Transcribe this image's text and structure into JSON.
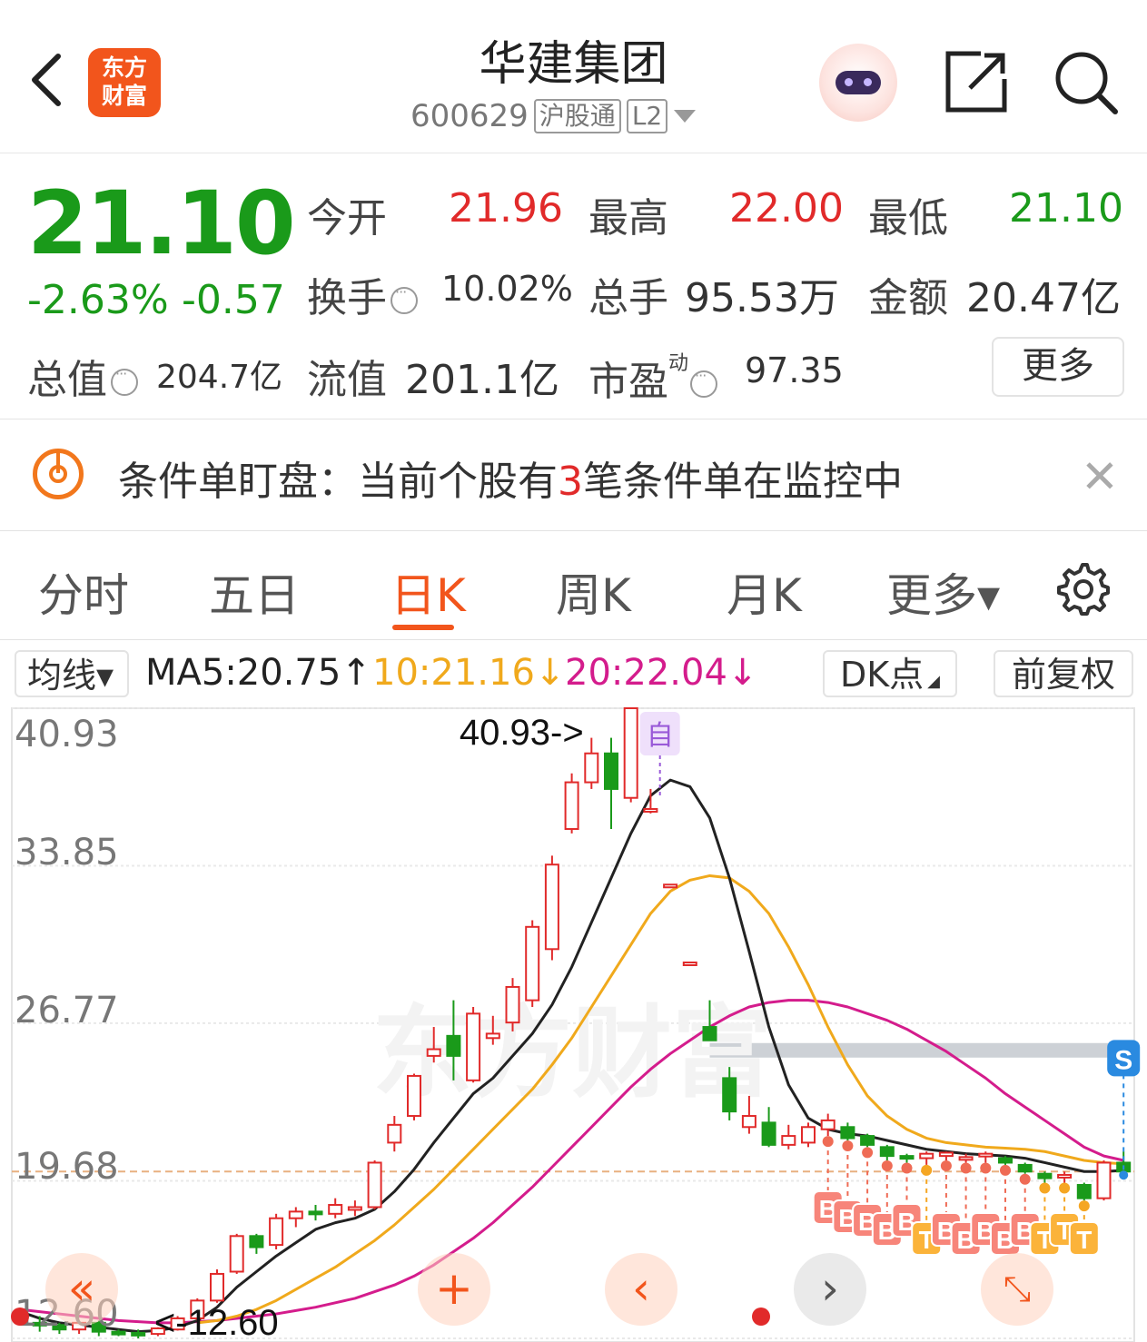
{
  "header": {
    "app_logo_text": "东方\n财富",
    "stock_name": "华建集团",
    "stock_code": "600629",
    "tags": [
      "沪股通",
      "L2"
    ]
  },
  "quote": {
    "price": "21.10",
    "change_pct": "-2.63%",
    "change_abs": "-0.57",
    "open_label": "今开",
    "open": "21.96",
    "high_label": "最高",
    "high": "22.00",
    "low_label": "最低",
    "low": "21.10",
    "turnover_label": "换手",
    "turnover": "10.02%",
    "volume_label": "总手",
    "volume": "95.53万",
    "amount_label": "金额",
    "amount": "20.47亿",
    "mktcap_label": "总值",
    "mktcap": "204.7亿",
    "float_label": "流值",
    "float_cap": "201.1亿",
    "pe_label": "市盈",
    "pe_sup": "动",
    "pe": "97.35",
    "more_label": "更多"
  },
  "alert": {
    "prefix": "条件单盯盘：当前个股有",
    "count": "3",
    "suffix": "笔条件单在监控中"
  },
  "tabs": [
    {
      "label": "分时"
    },
    {
      "label": "五日"
    },
    {
      "label": "日K"
    },
    {
      "label": "周K"
    },
    {
      "label": "月K"
    },
    {
      "label": "更多▾"
    }
  ],
  "indicator_bar": {
    "ma_select": "均线▾",
    "ma5": "MA5:20.75↑",
    "ma10": "10:21.16↓",
    "ma20": "20:22.04↓",
    "dk_label": "DK点",
    "adjust_label": "前复权",
    "colors": {
      "ma5": "#222222",
      "ma10": "#f0a91c",
      "ma20": "#d41c8c",
      "up": "#e12a2a",
      "down": "#1a9a1a"
    }
  },
  "chart_data": {
    "type": "candlestick",
    "y_ticks": [
      "40.93",
      "33.85",
      "26.77",
      "19.68",
      "12.60"
    ],
    "ylim": [
      12.6,
      40.93
    ],
    "max_annotation": "40.93->",
    "max_badge": "自",
    "min_annotation": "<-12.60",
    "sell_badge": "S",
    "signal_badges": [
      "B",
      "B",
      "B",
      "B",
      "B",
      "T",
      "B",
      "B",
      "B",
      "B",
      "B",
      "T",
      "T",
      "T"
    ],
    "watermark": "东方财富",
    "candles": [
      [
        13.6,
        13.9,
        13.2,
        13.4
      ],
      [
        13.3,
        13.6,
        12.9,
        13.2
      ],
      [
        13.2,
        13.3,
        12.8,
        13.0
      ],
      [
        13.0,
        13.4,
        12.8,
        13.3
      ],
      [
        13.3,
        13.4,
        12.7,
        12.9
      ],
      [
        12.9,
        13.0,
        12.7,
        12.85
      ],
      [
        12.85,
        13.0,
        12.6,
        12.8
      ],
      [
        12.8,
        13.1,
        12.7,
        13.05
      ],
      [
        13.0,
        13.6,
        12.95,
        13.5
      ],
      [
        13.5,
        14.4,
        13.4,
        14.3
      ],
      [
        14.3,
        15.7,
        14.2,
        15.5
      ],
      [
        15.6,
        17.3,
        15.5,
        17.2
      ],
      [
        17.2,
        17.3,
        16.4,
        16.7
      ],
      [
        16.8,
        18.2,
        16.6,
        18.0
      ],
      [
        18.0,
        18.5,
        17.6,
        18.3
      ],
      [
        18.3,
        18.6,
        17.9,
        18.2
      ],
      [
        18.2,
        18.9,
        18.0,
        18.6
      ],
      [
        18.4,
        18.8,
        18.1,
        18.5
      ],
      [
        18.5,
        20.6,
        18.4,
        20.5
      ],
      [
        21.4,
        22.6,
        21.0,
        22.2
      ],
      [
        22.6,
        24.5,
        22.4,
        24.4
      ],
      [
        25.3,
        26.6,
        25.0,
        25.6
      ],
      [
        26.2,
        27.8,
        24.2,
        25.3
      ],
      [
        24.2,
        27.5,
        24.1,
        27.2
      ],
      [
        26.1,
        27.1,
        25.8,
        26.3
      ],
      [
        26.8,
        28.8,
        26.4,
        28.4
      ],
      [
        27.8,
        31.4,
        27.5,
        31.1
      ],
      [
        30.1,
        34.3,
        29.6,
        33.9
      ],
      [
        35.5,
        38.0,
        35.3,
        37.6
      ],
      [
        37.6,
        39.6,
        37.3,
        38.9
      ],
      [
        38.9,
        39.6,
        35.5,
        37.3
      ],
      [
        36.9,
        40.93,
        36.7,
        40.93
      ],
      [
        36.4,
        37.3,
        36.2,
        36.4
      ],
      [
        33.0,
        33.0,
        33.0,
        33.0
      ],
      [
        29.5,
        29.5,
        29.5,
        29.5
      ],
      [
        26.6,
        27.8,
        26.0,
        26.0
      ],
      [
        24.3,
        24.8,
        22.4,
        22.8
      ],
      [
        22.1,
        23.5,
        21.8,
        22.6
      ],
      [
        22.3,
        23.0,
        21.2,
        21.3
      ],
      [
        21.3,
        22.2,
        21.1,
        21.7
      ],
      [
        21.4,
        22.3,
        21.2,
        22.1
      ],
      [
        22.0,
        22.7,
        21.7,
        22.4
      ],
      [
        22.1,
        22.3,
        21.5,
        21.6
      ],
      [
        21.7,
        21.8,
        21.2,
        21.3
      ],
      [
        21.2,
        21.3,
        20.6,
        20.8
      ],
      [
        20.8,
        20.9,
        20.5,
        20.7
      ],
      [
        20.7,
        21.0,
        20.4,
        20.9
      ],
      [
        20.8,
        21.0,
        20.6,
        20.95
      ],
      [
        20.7,
        20.9,
        20.5,
        20.75
      ],
      [
        20.8,
        21.0,
        20.5,
        20.9
      ],
      [
        20.7,
        20.8,
        20.4,
        20.5
      ],
      [
        20.4,
        20.5,
        20.0,
        20.1
      ],
      [
        20.0,
        20.1,
        19.6,
        19.8
      ],
      [
        19.9,
        20.1,
        19.6,
        19.95
      ],
      [
        19.5,
        19.6,
        18.8,
        18.9
      ],
      [
        18.9,
        20.6,
        18.8,
        20.5
      ],
      [
        20.5,
        21.0,
        20.0,
        20.1
      ]
    ],
    "ma5": [
      13.8,
      13.5,
      13.3,
      13.2,
      13.1,
      13.0,
      12.9,
      12.95,
      13.1,
      13.4,
      14.0,
      14.9,
      15.6,
      16.3,
      16.9,
      17.5,
      17.8,
      18.0,
      18.4,
      19.2,
      20.2,
      21.4,
      22.5,
      23.6,
      24.3,
      25.3,
      26.3,
      27.6,
      29.3,
      31.3,
      33.3,
      35.3,
      37.0,
      37.7,
      37.4,
      36.0,
      33.3,
      30.0,
      26.6,
      24.0,
      22.5,
      22.0,
      21.8,
      21.7,
      21.5,
      21.3,
      21.1,
      21.0,
      20.9,
      20.85,
      20.8,
      20.7,
      20.5,
      20.3,
      20.1,
      20.1,
      20.15
    ],
    "ma10": [
      null,
      null,
      null,
      null,
      null,
      null,
      null,
      null,
      null,
      13.3,
      13.4,
      13.6,
      13.9,
      14.3,
      14.8,
      15.3,
      15.8,
      16.4,
      17.0,
      17.7,
      18.5,
      19.3,
      20.2,
      21.1,
      22.0,
      22.9,
      23.8,
      24.9,
      26.1,
      27.5,
      28.9,
      30.3,
      31.7,
      32.7,
      33.2,
      33.4,
      33.3,
      32.7,
      31.7,
      30.2,
      28.5,
      26.6,
      24.9,
      23.5,
      22.6,
      22.0,
      21.6,
      21.4,
      21.3,
      21.2,
      21.15,
      21.1,
      21.0,
      20.8,
      20.6,
      20.5,
      20.45
    ],
    "ma20": [
      13.9,
      13.8,
      13.7,
      13.6,
      13.5,
      13.4,
      13.35,
      13.3,
      13.3,
      13.35,
      13.4,
      13.5,
      13.6,
      13.7,
      13.85,
      14.0,
      14.2,
      14.4,
      14.7,
      15.0,
      15.4,
      15.9,
      16.5,
      17.1,
      17.8,
      18.6,
      19.4,
      20.3,
      21.2,
      22.1,
      23.0,
      23.9,
      24.7,
      25.4,
      26.0,
      26.6,
      27.1,
      27.5,
      27.7,
      27.8,
      27.8,
      27.7,
      27.5,
      27.2,
      26.9,
      26.5,
      26.0,
      25.5,
      24.9,
      24.3,
      23.6,
      23.0,
      22.4,
      21.8,
      21.2,
      20.8,
      20.6
    ]
  }
}
